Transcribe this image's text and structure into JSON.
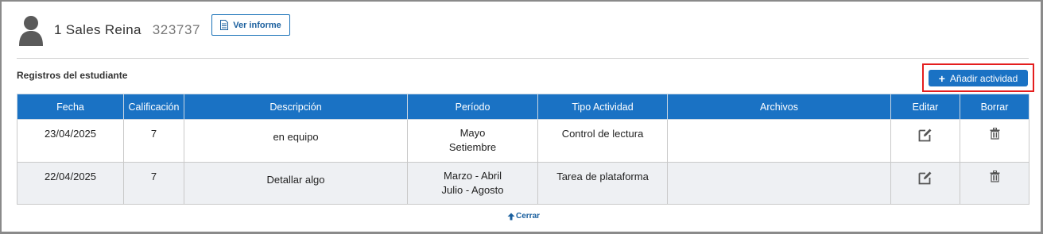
{
  "student": {
    "name": "1 Sales Reina",
    "id": "323737",
    "report_button": "Ver informe",
    "avatar_icon": "user-silhouette-icon"
  },
  "records": {
    "title": "Registros del estudiante",
    "add_button": "Añadir actividad",
    "highlight_color": "#e41e1e",
    "columns": [
      "Fecha",
      "Calificación",
      "Descripción",
      "Período",
      "Tipo Actividad",
      "Archivos",
      "Editar",
      "Borrar"
    ],
    "rows": [
      {
        "date": "23/04/2025",
        "grade": "7",
        "description": "en equipo",
        "period_line1": "Mayo",
        "period_line2": "Setiembre",
        "activity_type": "Control de lectura",
        "files": "",
        "edit_icon": "edit-icon",
        "delete_icon": "trash-icon"
      },
      {
        "date": "22/04/2025",
        "grade": "7",
        "description": "Detallar algo",
        "period_line1": "Marzo - Abril",
        "period_line2": "Julio - Agosto",
        "activity_type": "Tarea de plataforma",
        "files": "",
        "edit_icon": "edit-icon",
        "delete_icon": "trash-icon"
      }
    ],
    "close_link": "Cerrar"
  },
  "colors": {
    "primary": "#1a72c4",
    "row_alt": "#eef0f3"
  }
}
